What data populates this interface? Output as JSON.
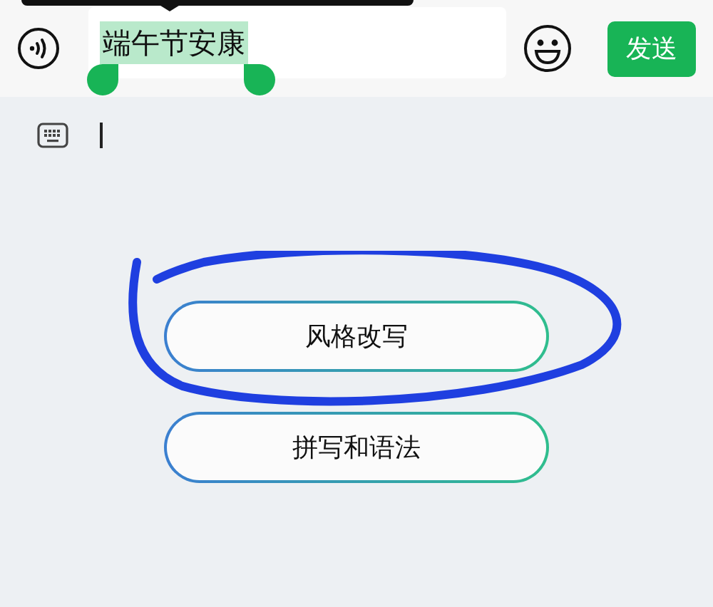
{
  "input_bar": {
    "text": "端午节安康",
    "text_selected": true,
    "send_label": "发送"
  },
  "tools": [
    {
      "label": "风格改写"
    },
    {
      "label": "拼写和语法"
    }
  ]
}
